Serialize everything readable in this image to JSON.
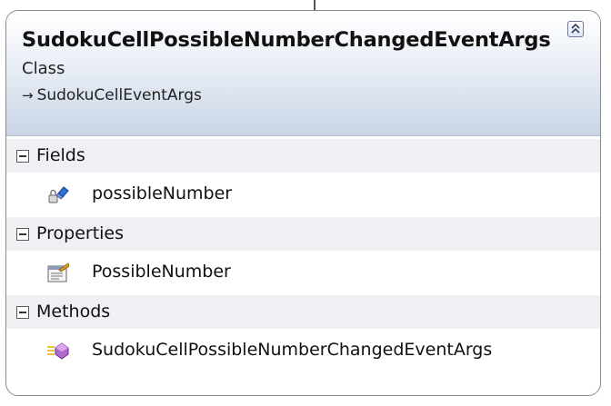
{
  "class": {
    "name": "SudokuCellPossibleNumberChangedEventArgs",
    "stereotype": "Class",
    "base_class": "SudokuCellEventArgs",
    "base_arrow_icon": "inheritance-arrow-icon",
    "collapse_icon": "double-chevron-up-icon"
  },
  "sections": {
    "fields": {
      "title": "Fields",
      "toggle_icon": "collapse-minus-icon",
      "members": [
        {
          "name": "possibleNumber",
          "icon": "private-field-icon"
        }
      ]
    },
    "properties": {
      "title": "Properties",
      "toggle_icon": "collapse-minus-icon",
      "members": [
        {
          "name": "PossibleNumber",
          "icon": "property-icon"
        }
      ]
    },
    "methods": {
      "title": "Methods",
      "toggle_icon": "collapse-minus-icon",
      "members": [
        {
          "name": "SudokuCellPossibleNumberChangedEventArgs",
          "icon": "constructor-method-icon"
        }
      ]
    }
  },
  "colors": {
    "header_gradient_end": "#c9d4e6",
    "border": "#8a8a8a",
    "section_header": "#eef0f3",
    "method_icon": "#9b59b6"
  }
}
